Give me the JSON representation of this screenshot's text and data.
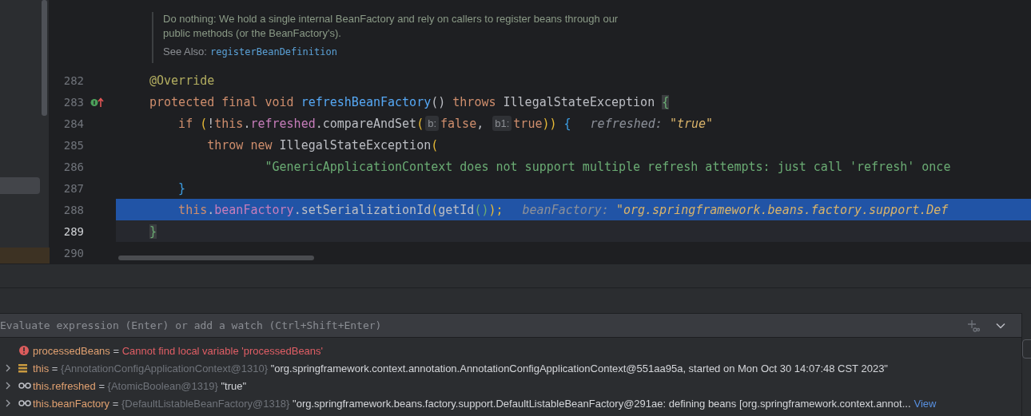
{
  "doc": {
    "text": "Do nothing: We hold a single internal BeanFactory and rely on callers to register beans through our public methods (or the BeanFactory's).",
    "see_also_label": "See Also:",
    "see_also_link": "registerBeanDefinition"
  },
  "code_lines": [
    {
      "number": "282",
      "implements_marker": false,
      "execution_point": false,
      "caret": false,
      "tokens": [
        {
          "text": "@Override",
          "kind": "annotation"
        }
      ]
    },
    {
      "number": "283",
      "implements_marker": true,
      "execution_point": false,
      "caret": false,
      "tokens": [
        {
          "text": "protected final void ",
          "kind": "keyword"
        },
        {
          "text": "refreshBeanFactory",
          "kind": "method"
        },
        {
          "text": "() ",
          "kind": "plain"
        },
        {
          "text": "throws ",
          "kind": "keyword"
        },
        {
          "text": "IllegalStateException ",
          "kind": "plain"
        },
        {
          "text": "{",
          "kind": "matched_brace"
        }
      ]
    },
    {
      "number": "284",
      "implements_marker": false,
      "execution_point": false,
      "caret": false,
      "tokens": [
        {
          "text": "    if ",
          "kind": "keyword"
        },
        {
          "text": "(",
          "kind": "paren_gold"
        },
        {
          "text": "!",
          "kind": "plain"
        },
        {
          "text": "this",
          "kind": "keyword"
        },
        {
          "text": ".",
          "kind": "plain"
        },
        {
          "text": "refreshed",
          "kind": "field"
        },
        {
          "text": ".compareAndSet",
          "kind": "plain"
        },
        {
          "text": "(",
          "kind": "paren_gold"
        },
        {
          "text": "b:",
          "kind": "param_hint"
        },
        {
          "text": "false",
          "kind": "keyword"
        },
        {
          "text": ", ",
          "kind": "plain"
        },
        {
          "text": "b1:",
          "kind": "param_hint"
        },
        {
          "text": "true",
          "kind": "keyword"
        },
        {
          "text": "))",
          "kind": "paren_gold"
        },
        {
          "text": " {",
          "kind": "paren_blue"
        },
        {
          "text": "refreshed: ",
          "kind": "hint"
        },
        {
          "text": "\"true\"",
          "kind": "hint_value"
        }
      ]
    },
    {
      "number": "285",
      "implements_marker": false,
      "execution_point": false,
      "caret": false,
      "tokens": [
        {
          "text": "        throw new ",
          "kind": "keyword"
        },
        {
          "text": "IllegalStateException",
          "kind": "plain"
        },
        {
          "text": "(",
          "kind": "paren_gold"
        }
      ]
    },
    {
      "number": "286",
      "implements_marker": false,
      "execution_point": false,
      "caret": false,
      "tokens": [
        {
          "text": "                \"GenericApplicationContext does not support multiple refresh attempts: just call 'refresh' once",
          "kind": "string"
        }
      ]
    },
    {
      "number": "287",
      "implements_marker": false,
      "execution_point": false,
      "caret": false,
      "tokens": [
        {
          "text": "    }",
          "kind": "paren_blue"
        }
      ]
    },
    {
      "number": "288",
      "implements_marker": false,
      "execution_point": true,
      "caret": false,
      "tokens": [
        {
          "text": "    this",
          "kind": "keyword"
        },
        {
          "text": ".",
          "kind": "plain"
        },
        {
          "text": "beanFactory",
          "kind": "field"
        },
        {
          "text": ".setSerializationId",
          "kind": "plain"
        },
        {
          "text": "(",
          "kind": "paren_gold"
        },
        {
          "text": "getId",
          "kind": "plain"
        },
        {
          "text": "()",
          "kind": "paren_green"
        },
        {
          "text": ");",
          "kind": "paren_gold"
        },
        {
          "text": "beanFactory: ",
          "kind": "hint"
        },
        {
          "text": "\"org.springframework.beans.factory.support.Def",
          "kind": "hint_value"
        }
      ]
    },
    {
      "number": "289",
      "implements_marker": false,
      "execution_point": false,
      "caret": true,
      "tokens": [
        {
          "text": "}",
          "kind": "matched_brace"
        }
      ]
    },
    {
      "number": "290",
      "implements_marker": false,
      "execution_point": false,
      "caret": false
    }
  ],
  "evaluate": {
    "placeholder": "Evaluate expression (Enter) or add a watch (Ctrl+Shift+Enter)"
  },
  "variables": [
    {
      "kind": "error",
      "expandable": false,
      "name": "processedBeans",
      "operator": "=",
      "value": "Cannot find local variable 'processedBeans'"
    },
    {
      "kind": "object",
      "expandable": true,
      "name": "this",
      "operator": "=",
      "type": "{AnnotationConfigApplicationContext@1310}",
      "value": "\"org.springframework.context.annotation.AnnotationConfigApplicationContext@551aa95a, started on Mon Oct 30 14:07:48 CST 2023\""
    },
    {
      "kind": "watch",
      "expandable": true,
      "name": "this.refreshed",
      "operator": "=",
      "type": "{AtomicBoolean@1319}",
      "value": "\"true\""
    },
    {
      "kind": "watch",
      "expandable": true,
      "name": "this.beanFactory",
      "operator": "=",
      "type": "{DefaultListableBeanFactory@1318}",
      "value": "\"org.springframework.beans.factory.support.DefaultListableBeanFactory@291ae: defining beans [org.springframework.context.annot...",
      "link": "View"
    }
  ]
}
